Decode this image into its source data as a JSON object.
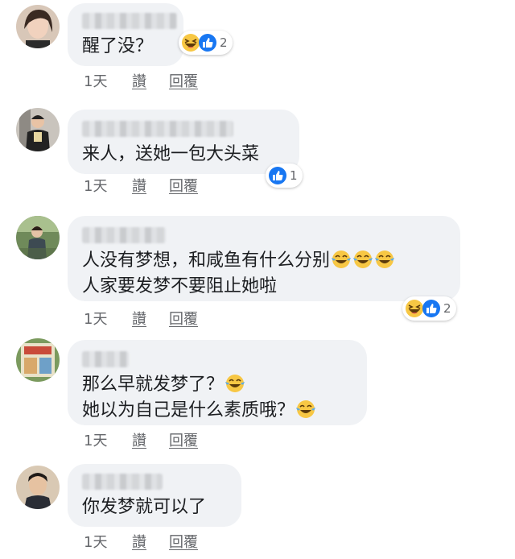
{
  "comments": [
    {
      "text_lines": [
        "醒了没？"
      ],
      "reactions": {
        "icons": [
          "haha-reaction-icon",
          "like-reaction-icon"
        ],
        "count": "2"
      },
      "time": "1天",
      "like_label": "讚",
      "reply_label": "回覆"
    },
    {
      "text_lines": [
        "来人，送她一包大头菜"
      ],
      "reactions": {
        "icons": [
          "like-reaction-icon"
        ],
        "count": "1"
      },
      "time": "1天",
      "like_label": "讚",
      "reply_label": "回覆"
    },
    {
      "text_lines": [
        "人没有梦想，和咸鱼有什么分别",
        "人家要发梦不要阻止她啦"
      ],
      "inline_emoji": [
        "tears-of-joy-emoji",
        "tears-of-joy-emoji",
        "tears-of-joy-emoji"
      ],
      "reactions": {
        "icons": [
          "haha-reaction-icon",
          "like-reaction-icon"
        ],
        "count": "2"
      },
      "time": "1天",
      "like_label": "讚",
      "reply_label": "回覆"
    },
    {
      "text_lines": [
        "那么早就发梦了？",
        "她以为自己是什么素质哦？"
      ],
      "inline_emoji": [
        "tears-of-joy-emoji",
        "tears-of-joy-emoji"
      ],
      "time": "1天",
      "like_label": "讚",
      "reply_label": "回覆"
    },
    {
      "text_lines": [
        "你发梦就可以了"
      ],
      "time": "1天",
      "like_label": "讚",
      "reply_label": "回覆"
    }
  ],
  "colors": {
    "bubble": "#f0f2f5",
    "like_blue": "#1877f2",
    "haha_yellow": "#f7c744",
    "meta_gray": "#65676b"
  }
}
